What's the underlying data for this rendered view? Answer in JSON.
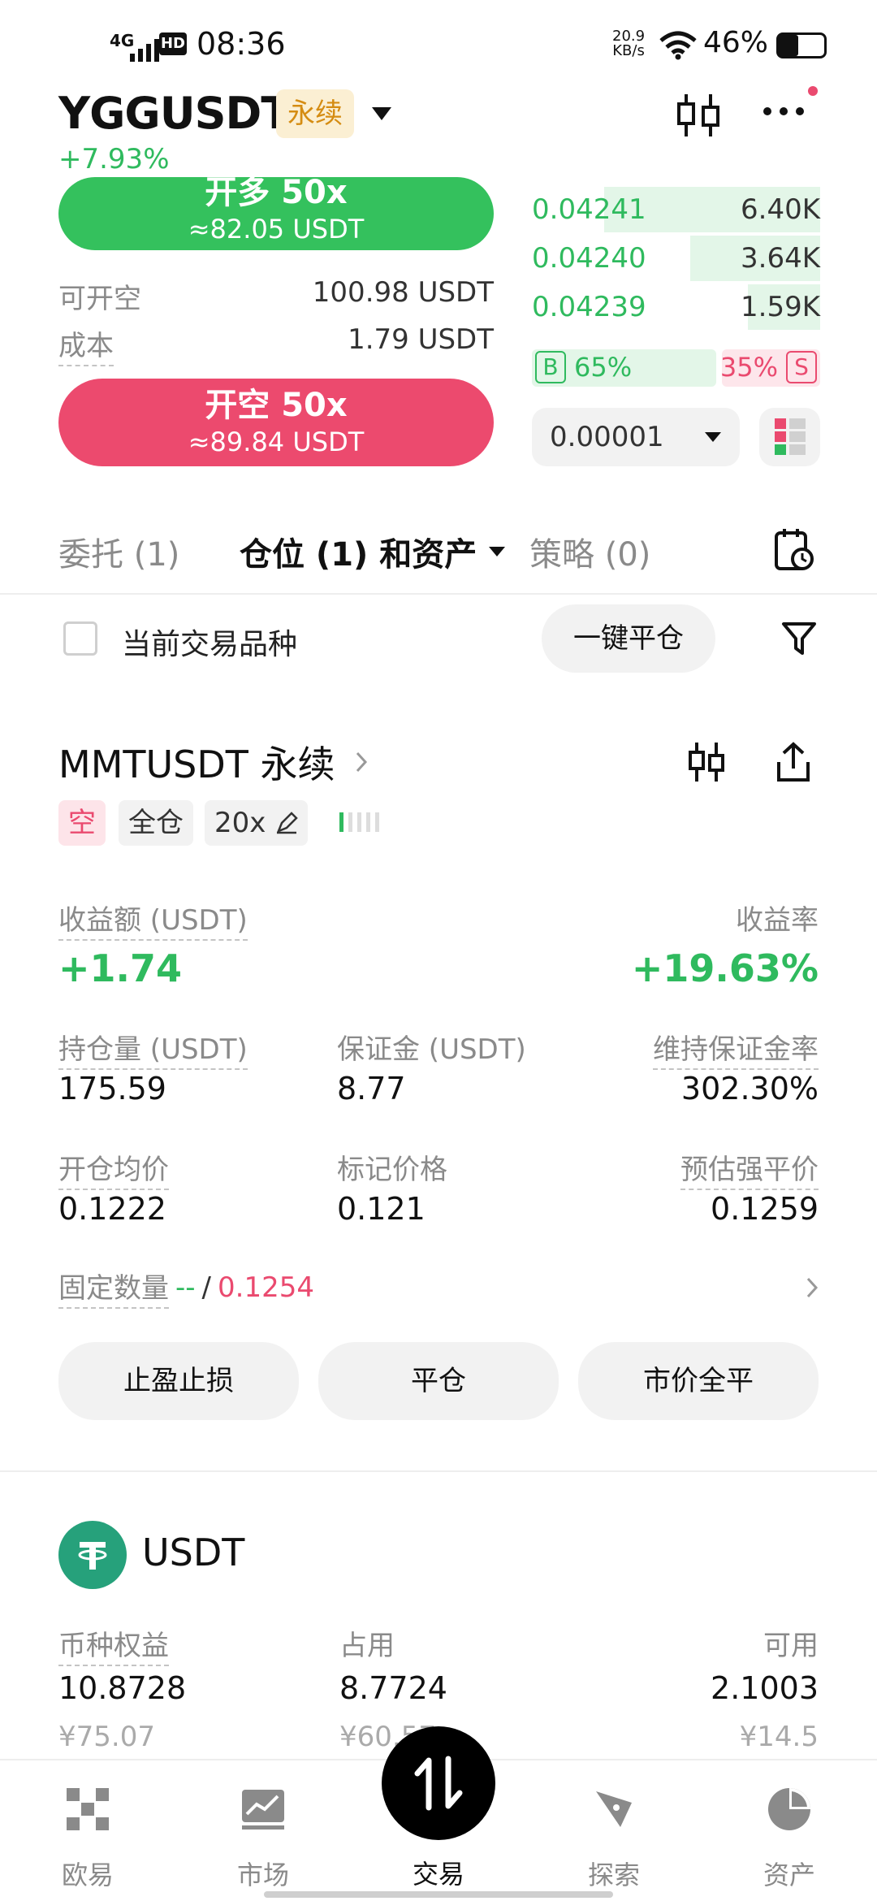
{
  "status": {
    "network": "4G",
    "hd": "HD",
    "time": "08:36",
    "speed_value": "20.9",
    "speed_unit": "KB/s",
    "battery": "46%"
  },
  "header": {
    "pair": "YGGUSDT",
    "type_badge": "永续",
    "change": "+7.93%"
  },
  "order": {
    "long_label": "开多 50x",
    "long_sub": "≈82.05 USDT",
    "avail_short_label": "可开空",
    "avail_short_value": "100.98 USDT",
    "cost_label": "成本",
    "cost_value": "1.79 USDT",
    "short_label": "开空 50x",
    "short_sub": "≈89.84 USDT"
  },
  "orderbook": {
    "rows": [
      {
        "price": "0.04241",
        "qty": "6.40K",
        "depth": 0.75
      },
      {
        "price": "0.04240",
        "qty": "3.64K",
        "depth": 0.45
      },
      {
        "price": "0.04239",
        "qty": "1.59K",
        "depth": 0.25
      }
    ],
    "buy_label": "B",
    "buy_pct": "65%",
    "sell_pct": "35%",
    "sell_label": "S",
    "buy_ratio": 0.65,
    "precision": "0.00001"
  },
  "tabs": {
    "orders": "委托 (1)",
    "positions": "仓位 (1) 和资产",
    "strategy": "策略 (0)"
  },
  "filter": {
    "current_label": "当前交易品种",
    "close_all": "一键平仓"
  },
  "position": {
    "symbol": "MMTUSDT 永续",
    "side": "空",
    "margin_mode": "全仓",
    "leverage": "20x",
    "pnl_label": "收益额 (USDT)",
    "pnl_value": "+1.74",
    "roi_label": "收益率",
    "roi_value": "+19.63%",
    "size_label": "持仓量 (USDT)",
    "size_value": "175.59",
    "margin_label": "保证金 (USDT)",
    "margin_value": "8.77",
    "mmr_label": "维持保证金率",
    "mmr_value": "302.30%",
    "entry_label": "开仓均价",
    "entry_value": "0.1222",
    "mark_label": "标记价格",
    "mark_value": "0.121",
    "liq_label": "预估强平价",
    "liq_value": "0.1259",
    "fixed_label": "固定数量",
    "fixed_tp": "--",
    "fixed_sep": "/",
    "fixed_sl": "0.1254",
    "btn_tpsl": "止盈止损",
    "btn_close": "平仓",
    "btn_market_close": "市价全平"
  },
  "asset": {
    "name": "USDT",
    "equity_label": "币种权益",
    "equity_value": "10.8728",
    "equity_cny": "¥75.07",
    "used_label": "占用",
    "used_value": "8.7724",
    "used_cny": "¥60.57",
    "avail_label": "可用",
    "avail_value": "2.1003",
    "avail_cny": "¥14.5"
  },
  "nav": {
    "okx": "欧易",
    "market": "市场",
    "trade": "交易",
    "explore": "探索",
    "assets": "资产"
  }
}
